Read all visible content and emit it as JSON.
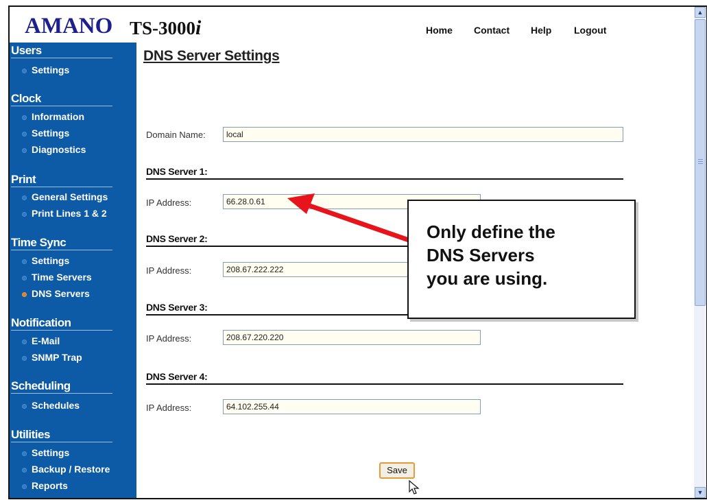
{
  "header": {
    "brand": "AMANO",
    "model_prefix": "TS-3000",
    "model_suffix": "i",
    "nav": [
      "Home",
      "Contact",
      "Help",
      "Logout"
    ]
  },
  "sidebar": {
    "sections": [
      {
        "title": "Users",
        "items": [
          "Settings"
        ]
      },
      {
        "title": "Clock",
        "items": [
          "Information",
          "Settings",
          "Diagnostics"
        ]
      },
      {
        "title": "Print",
        "items": [
          "General Settings",
          "Print Lines 1 & 2"
        ]
      },
      {
        "title": "Time Sync",
        "items": [
          "Settings",
          "Time Servers",
          "DNS Servers"
        ]
      },
      {
        "title": "Notification",
        "items": [
          "E-Mail",
          "SNMP Trap"
        ]
      },
      {
        "title": "Scheduling",
        "items": [
          "Schedules"
        ]
      },
      {
        "title": "Utilities",
        "items": [
          "Settings",
          "Backup / Restore",
          "Reports"
        ]
      }
    ]
  },
  "main": {
    "title": "DNS Server Settings",
    "domain_label": "Domain Name:",
    "domain_value": "local",
    "ip_label": "IP Address:",
    "servers": [
      {
        "heading": "DNS Server 1:",
        "ip": "66.28.0.61"
      },
      {
        "heading": "DNS Server 2:",
        "ip": "208.67.222.222"
      },
      {
        "heading": "DNS Server 3:",
        "ip": "208.67.220.220"
      },
      {
        "heading": "DNS Server 4:",
        "ip": "64.102.255.44"
      }
    ],
    "save_label": "Save"
  },
  "callout": {
    "lines": [
      "Only define the",
      "DNS Servers",
      "you are using."
    ]
  },
  "colors": {
    "sidebar_bg": "#0d5aa7",
    "brand": "#1e1e8c",
    "arrow": "#e8141b",
    "save_border": "#e39b3a"
  }
}
